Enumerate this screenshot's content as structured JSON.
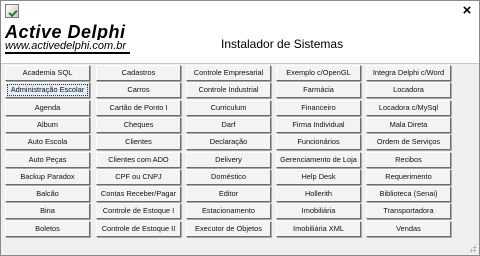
{
  "window": {
    "close_glyph": "×"
  },
  "header": {
    "logo_title": "Active Delphi",
    "logo_url": "www.activedelphi.com.br",
    "title": "Instalador de Sistemas"
  },
  "columns": [
    [
      "Academia SQL",
      "Administração Escolar",
      "Agenda",
      "Album",
      "Auto Escola",
      "Auto Peças",
      "Backup Paradox",
      "Balcão",
      "Bina",
      "Boletos"
    ],
    [
      "Cadastros",
      "Carros",
      "Cartão de Ponto I",
      "Cheques",
      "Clientes",
      "Clientes com ADO",
      "CPF ou CNPJ",
      "Contas Receber/Pagar",
      "Controle de Estoque I",
      "Controle de Estoque II"
    ],
    [
      "Controle Empresarial",
      "Controle Industrial",
      "Curriculum",
      "Darf",
      "Declaração",
      "Delivery",
      "Doméstico",
      "Editor",
      "Estacionamento",
      "Executor de Objetos"
    ],
    [
      "Exemplo c/OpenGL",
      "Farmácia",
      "Financeiro",
      "Firma Individual",
      "Funcionários",
      "Gerenciamento de Loja",
      "Help Desk",
      "Hollerith",
      "Imobiliária",
      "Imobiliária XML"
    ],
    [
      "Integra Delphi c/Word",
      "Locadora",
      "Locadora c/MySql",
      "Mala Direta",
      "Ordem de Serviços",
      "Recibos",
      "Requerimento",
      "Biblioteca (Senai)",
      "Transportadora",
      "Vendas"
    ]
  ],
  "active_button": "Administração Escolar"
}
